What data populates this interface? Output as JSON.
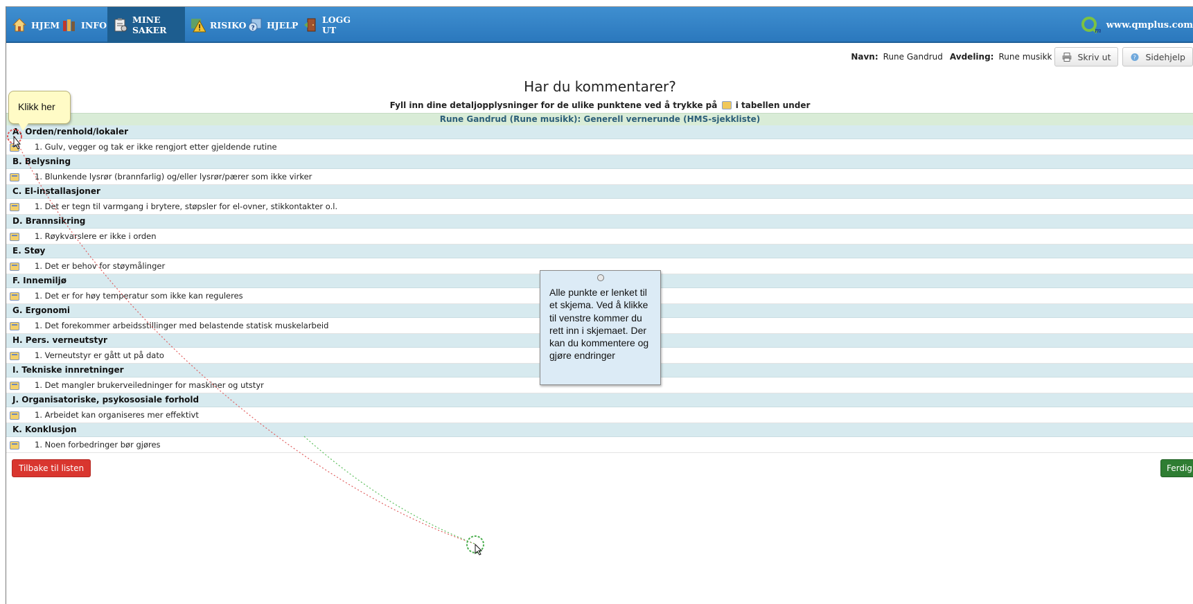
{
  "nav": {
    "items": [
      {
        "label": "HJEM",
        "icon": "home-icon",
        "active": false
      },
      {
        "label": "INFO",
        "icon": "books-icon",
        "active": false
      },
      {
        "label": "MINE SAKER",
        "icon": "clipboard-icon",
        "active": true
      },
      {
        "label": "RISIKO",
        "icon": "warning-icon",
        "active": false
      },
      {
        "label": "HJELP",
        "icon": "help-icon",
        "active": false
      },
      {
        "label": "LOGG UT",
        "icon": "logout-door-icon",
        "active": false
      }
    ],
    "brand": "www.qmplus.com"
  },
  "userbar": {
    "name_label": "Navn:",
    "name_value": "Rune Gandrud",
    "dept_label": "Avdeling:",
    "dept_value": "Rune musikk",
    "print_label": "Skriv ut",
    "help_label": "Sidehjelp"
  },
  "page": {
    "title": "Har du kommentarer?",
    "subtitle_before": "Fyll inn dine detaljopplysninger for de ulike punktene ved å trykke på",
    "subtitle_after": "i tabellen under",
    "list_header": "Rune Gandrud (Rune musikk): Generell vernerunde (HMS-sjekkliste)"
  },
  "sections": [
    {
      "title": "A. Orden/renhold/lokaler",
      "item": "1. Gulv, vegger og tak er ikke rengjort etter gjeldende rutine"
    },
    {
      "title": "B. Belysning",
      "item": "1.  Blunkende lysrør (brannfarlig) og/eller lysrør/pærer som ikke virker"
    },
    {
      "title": "C. El-installasjoner",
      "item": "1. Det er tegn til varmgang i brytere, støpsler for el-ovner, stikkontakter o.l."
    },
    {
      "title": "D. Brannsikring",
      "item": "1. Røykvarslere er ikke i orden"
    },
    {
      "title": "E. Støy",
      "item": "1. Det er behov for støymålinger"
    },
    {
      "title": "F. Innemiljø",
      "item": "1. Det er for høy temperatur som ikke kan reguleres"
    },
    {
      "title": "G. Ergonomi",
      "item": "1. Det forekommer arbeidsstillinger med belastende statisk muskelarbeid"
    },
    {
      "title": "H. Pers. verneutstyr",
      "item": "1. Verneutstyr er gått ut på dato"
    },
    {
      "title": "I. Tekniske innretninger",
      "item": "1. Det mangler brukerveiledninger for maskiner og utstyr"
    },
    {
      "title": "J. Organisatoriske, psykososiale forhold",
      "item": "1. Arbeidet kan organiseres mer effektivt"
    },
    {
      "title": "K. Konklusjon",
      "item": "1. Noen forbedringer bør gjøres"
    }
  ],
  "buttons": {
    "back": "Tilbake til listen",
    "done": "Ferdig"
  },
  "callouts": {
    "tip": "Klikk her",
    "note": "Alle punkte er lenket til et skjema. Ved å klikke til venstre kommer du rett inn i skjemaet. Der kan du kommentere og gjøre endringer"
  },
  "colors": {
    "nav_bg": "#2f82c6",
    "nav_active": "#1d5d8f",
    "section_bg": "#d7eaef",
    "list_header_bg": "#d9ecd7",
    "back_button": "#d9362f",
    "done_button": "#2e7d32",
    "tip_bg": "#fffbc6",
    "note_bg": "#dcebf6"
  }
}
